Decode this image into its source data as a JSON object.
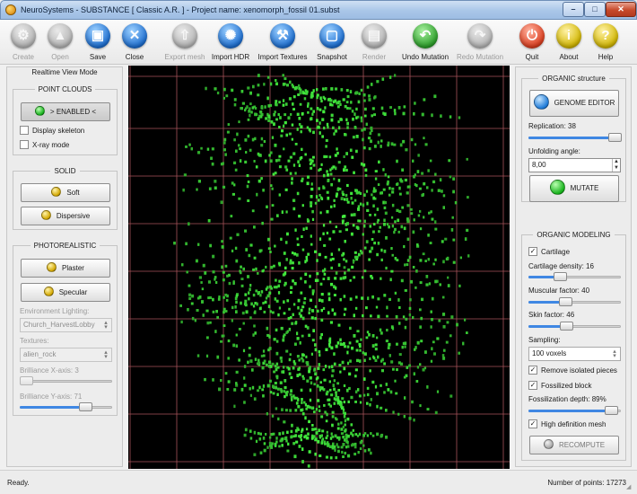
{
  "window": {
    "title": "NeuroSystems - SUBSTANCE  [ Classic A.R. ]  -  Project name: xenomorph_fossil 01.subst",
    "controls": {
      "minimize": "–",
      "maximize": "□",
      "close": "✕"
    }
  },
  "toolbar": {
    "items": [
      {
        "label": "Create",
        "icon": "gear-icon",
        "glyph": "⚙",
        "enabled": false
      },
      {
        "label": "Open",
        "icon": "folder-open-icon",
        "glyph": "▲",
        "enabled": false
      },
      {
        "label": "Save",
        "icon": "floppy-disk-icon",
        "glyph": "▣",
        "enabled": true
      },
      {
        "label": "Close",
        "icon": "close-icon",
        "glyph": "✕",
        "enabled": true
      },
      {
        "label": "Export mesh",
        "icon": "export-icon",
        "glyph": "⇧",
        "enabled": false
      },
      {
        "label": "Import HDR",
        "icon": "light-bulb-icon",
        "glyph": "✺",
        "enabled": true
      },
      {
        "label": "Import Textures",
        "icon": "hammer-icon",
        "glyph": "⚒",
        "enabled": true
      },
      {
        "label": "Snapshot",
        "icon": "camera-icon",
        "glyph": "▢",
        "enabled": true
      },
      {
        "label": "Render",
        "icon": "render-icon",
        "glyph": "▤",
        "enabled": false
      },
      {
        "label": "Undo Mutation",
        "icon": "undo-icon",
        "glyph": "↶",
        "enabled": true
      },
      {
        "label": "Redo Mutation",
        "icon": "redo-icon",
        "glyph": "↷",
        "enabled": false
      },
      {
        "label": "Quit",
        "icon": "power-icon",
        "glyph": "⏻",
        "enabled": true
      },
      {
        "label": "About",
        "icon": "info-icon",
        "glyph": "i",
        "enabled": true
      },
      {
        "label": "Help",
        "icon": "help-icon",
        "glyph": "?",
        "enabled": true
      }
    ]
  },
  "left_panel": {
    "title": "Realtime View Mode",
    "point_clouds": {
      "title": "POINT CLOUDS",
      "enabled_button": "> ENABLED <",
      "display_skeleton": {
        "label": "Display skeleton",
        "checked": false
      },
      "xray_mode": {
        "label": "X-ray mode",
        "checked": false
      }
    },
    "solid": {
      "title": "SOLID",
      "soft_button": "Soft",
      "dispersive_button": "Dispersive"
    },
    "photorealistic": {
      "title": "PHOTOREALISTIC",
      "plaster_button": "Plaster",
      "specular_button": "Specular",
      "environment_lighting": {
        "label": "Environment Lighting:",
        "value": "Church_HarvestLobby"
      },
      "textures": {
        "label": "Textures:",
        "value": "alien_rock"
      },
      "brilliance_x": {
        "label": "Brilliance X-axis: 3",
        "value_pct": 3
      },
      "brilliance_y": {
        "label": "Brilliance Y-axis: 71",
        "value_pct": 71
      }
    }
  },
  "right_panel": {
    "organic_structure": {
      "title": "ORGANIC structure",
      "genome_editor_button": "GENOME EDITOR",
      "replication": {
        "label": "Replication: 38",
        "value_pct": 95
      },
      "unfolding_angle": {
        "label": "Unfolding angle:",
        "value": "8,00"
      },
      "mutate_button": "MUTATE"
    },
    "organic_modeling": {
      "title": "ORGANIC MODELING",
      "cartilage": {
        "label": "Cartilage",
        "checked": true
      },
      "cartilage_density": {
        "label": "Cartilage density: 16",
        "value_pct": 34
      },
      "muscular_factor": {
        "label": "Muscular factor: 40",
        "value_pct": 40
      },
      "skin_factor": {
        "label": "Skin factor: 46",
        "value_pct": 41
      },
      "sampling": {
        "label": "Sampling:",
        "value": "100 voxels"
      },
      "remove_isolated": {
        "label": "Remove isolated pieces",
        "checked": true
      },
      "fossilized_block": {
        "label": "Fossilized block",
        "checked": true
      },
      "fossilization_depth": {
        "label": "Fossilization depth: 89%",
        "value_pct": 89
      },
      "high_definition": {
        "label": "High definition mesh",
        "checked": true
      },
      "recompute_button": "RECOMPUTE"
    }
  },
  "status": {
    "text": "Ready.",
    "points": "Number of points: 17273"
  },
  "colors": {
    "viewport_bg": "#000000",
    "grid_line": "#a8535a",
    "point_green": "#3fc23f",
    "slider_fill": "#3f87e3"
  }
}
